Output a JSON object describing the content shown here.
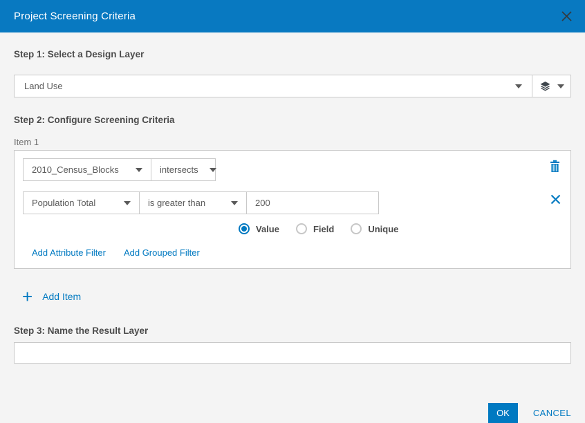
{
  "colors": {
    "accent": "#0079c1",
    "header_bg": "#0879c1",
    "text": "#4c4c4c",
    "secondary_text": "#595959",
    "border": "#c9c9c9",
    "background": "#f4f4f4"
  },
  "header": {
    "title": "Project Screening Criteria"
  },
  "step1": {
    "label": "Step 1: Select a Design Layer",
    "layer_dropdown": {
      "value": "Land Use"
    }
  },
  "step2": {
    "label": "Step 2: Configure Screening Criteria",
    "item": {
      "label": "Item 1",
      "layer_dropdown": {
        "value": "2010_Census_Blocks"
      },
      "spatial_operator_dropdown": {
        "value": "intersects"
      },
      "attribute_filter": {
        "field_dropdown": {
          "value": "Population Total"
        },
        "operator_dropdown": {
          "value": "is greater than"
        },
        "value_input": {
          "value": "200"
        },
        "modes": [
          {
            "label": "Value",
            "selected": true
          },
          {
            "label": "Field",
            "selected": false
          },
          {
            "label": "Unique",
            "selected": false
          }
        ]
      },
      "add_attribute_filter_label": "Add Attribute Filter",
      "add_grouped_filter_label": "Add Grouped Filter"
    },
    "add_item_label": "Add Item"
  },
  "step3": {
    "label": "Step 3: Name the Result Layer",
    "name_input": {
      "value": ""
    }
  },
  "footer": {
    "ok_label": "OK",
    "cancel_label": "CANCEL"
  }
}
